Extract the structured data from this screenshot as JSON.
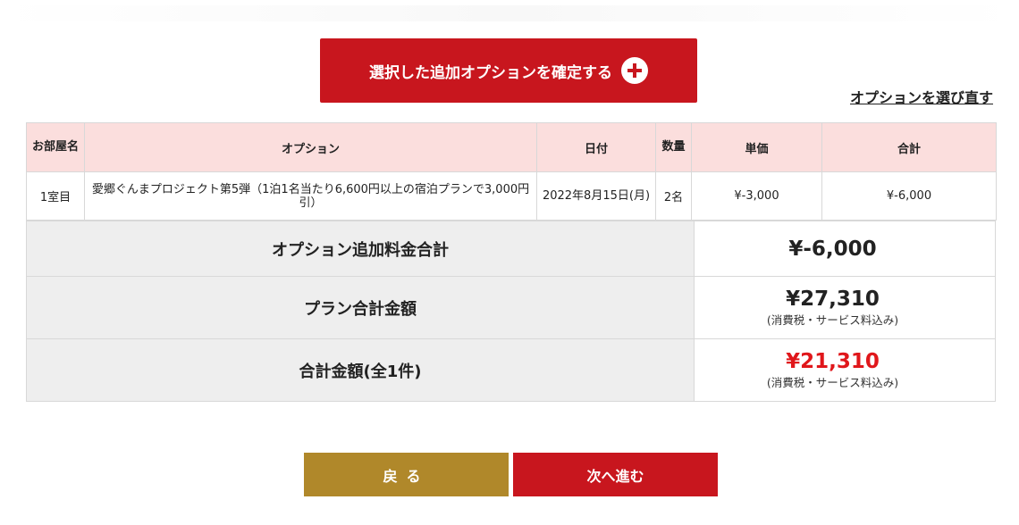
{
  "confirm_button": {
    "label": "選択した追加オプションを確定する",
    "icon": "plus-circle-icon"
  },
  "reselect_link": "オプションを選び直す",
  "table": {
    "headers": [
      "お部屋名",
      "オプション",
      "日付",
      "数量",
      "単価",
      "合計"
    ],
    "rows": [
      {
        "room": "1室目",
        "option": "愛郷ぐんまプロジェクト第5弾（1泊1名当たり6,600円以上の宿泊プランで3,000円引）",
        "date": "2022年8月15日(月)",
        "quantity": "2名",
        "unit_price": "¥-3,000",
        "total": "¥-6,000"
      }
    ]
  },
  "summary": {
    "option_total_label": "オプション追加料金合計",
    "option_total_value": "¥-6,000",
    "plan_total_label": "プラン合計金額",
    "plan_total_value": "¥27,310",
    "plan_total_note": "(消費税・サービス料込み)",
    "grand_total_label": "合計金額(全1件)",
    "grand_total_value": "¥21,310",
    "grand_total_note": "(消費税・サービス料込み)"
  },
  "buttons": {
    "back": "戻る",
    "next": "次へ進む"
  },
  "colors": {
    "primary_red": "#c8161e",
    "gold": "#b0882a",
    "header_pink": "#fbdedd",
    "summary_gray": "#eeeeee",
    "total_red": "#e0171b"
  }
}
